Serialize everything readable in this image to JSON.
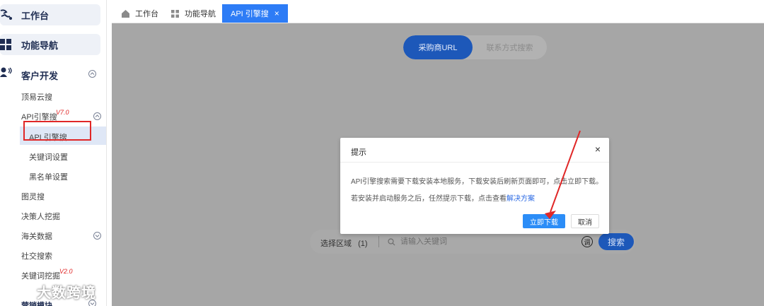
{
  "sidebar": {
    "workbench_label": "工作台",
    "function_nav_label": "功能导航",
    "customer_dev_label": "客户开发",
    "items": [
      {
        "label": "顶易云搜"
      },
      {
        "label": "API引擎搜",
        "version": "V7.0"
      },
      {
        "label": "API 引擎搜"
      },
      {
        "label": "关键词设置"
      },
      {
        "label": "黑名单设置"
      },
      {
        "label": "图灵搜"
      },
      {
        "label": "决策人挖掘"
      },
      {
        "label": "海关数据"
      },
      {
        "label": "社交搜索"
      },
      {
        "label": "关键词挖掘",
        "version": "V2.0"
      },
      {
        "label": "营销模块"
      }
    ],
    "watermark": "大数跨境"
  },
  "tabs": [
    {
      "label": "工作台",
      "icon": "home-icon"
    },
    {
      "label": "功能导航",
      "icon": "grid-icon"
    },
    {
      "label": "API 引擎搜",
      "close": "×"
    }
  ],
  "toggle": {
    "option_a": "采购商URL",
    "option_b": "联系方式搜索"
  },
  "search": {
    "region_label": "选择区域",
    "region_count": "(1)",
    "placeholder": "请输入关键词",
    "tiao_icon_text": "调",
    "button_label": "搜索"
  },
  "modal": {
    "title": "提示",
    "close": "×",
    "line1": "API引擎搜索需要下载安装本地服务，下载安装后刷新页面即可，点击立即下载。",
    "line2_prefix": "若安装并启动服务之后，任然提示下载，点击查看",
    "line2_link": "解决方案",
    "ok_label": "立即下载",
    "cancel_label": "取消"
  },
  "colors": {
    "accent": "#2d7cf6",
    "sidebar_selected": "#dfe7f6",
    "annotation_red": "#e02727",
    "overlay_gray": "#a6a6a6"
  }
}
